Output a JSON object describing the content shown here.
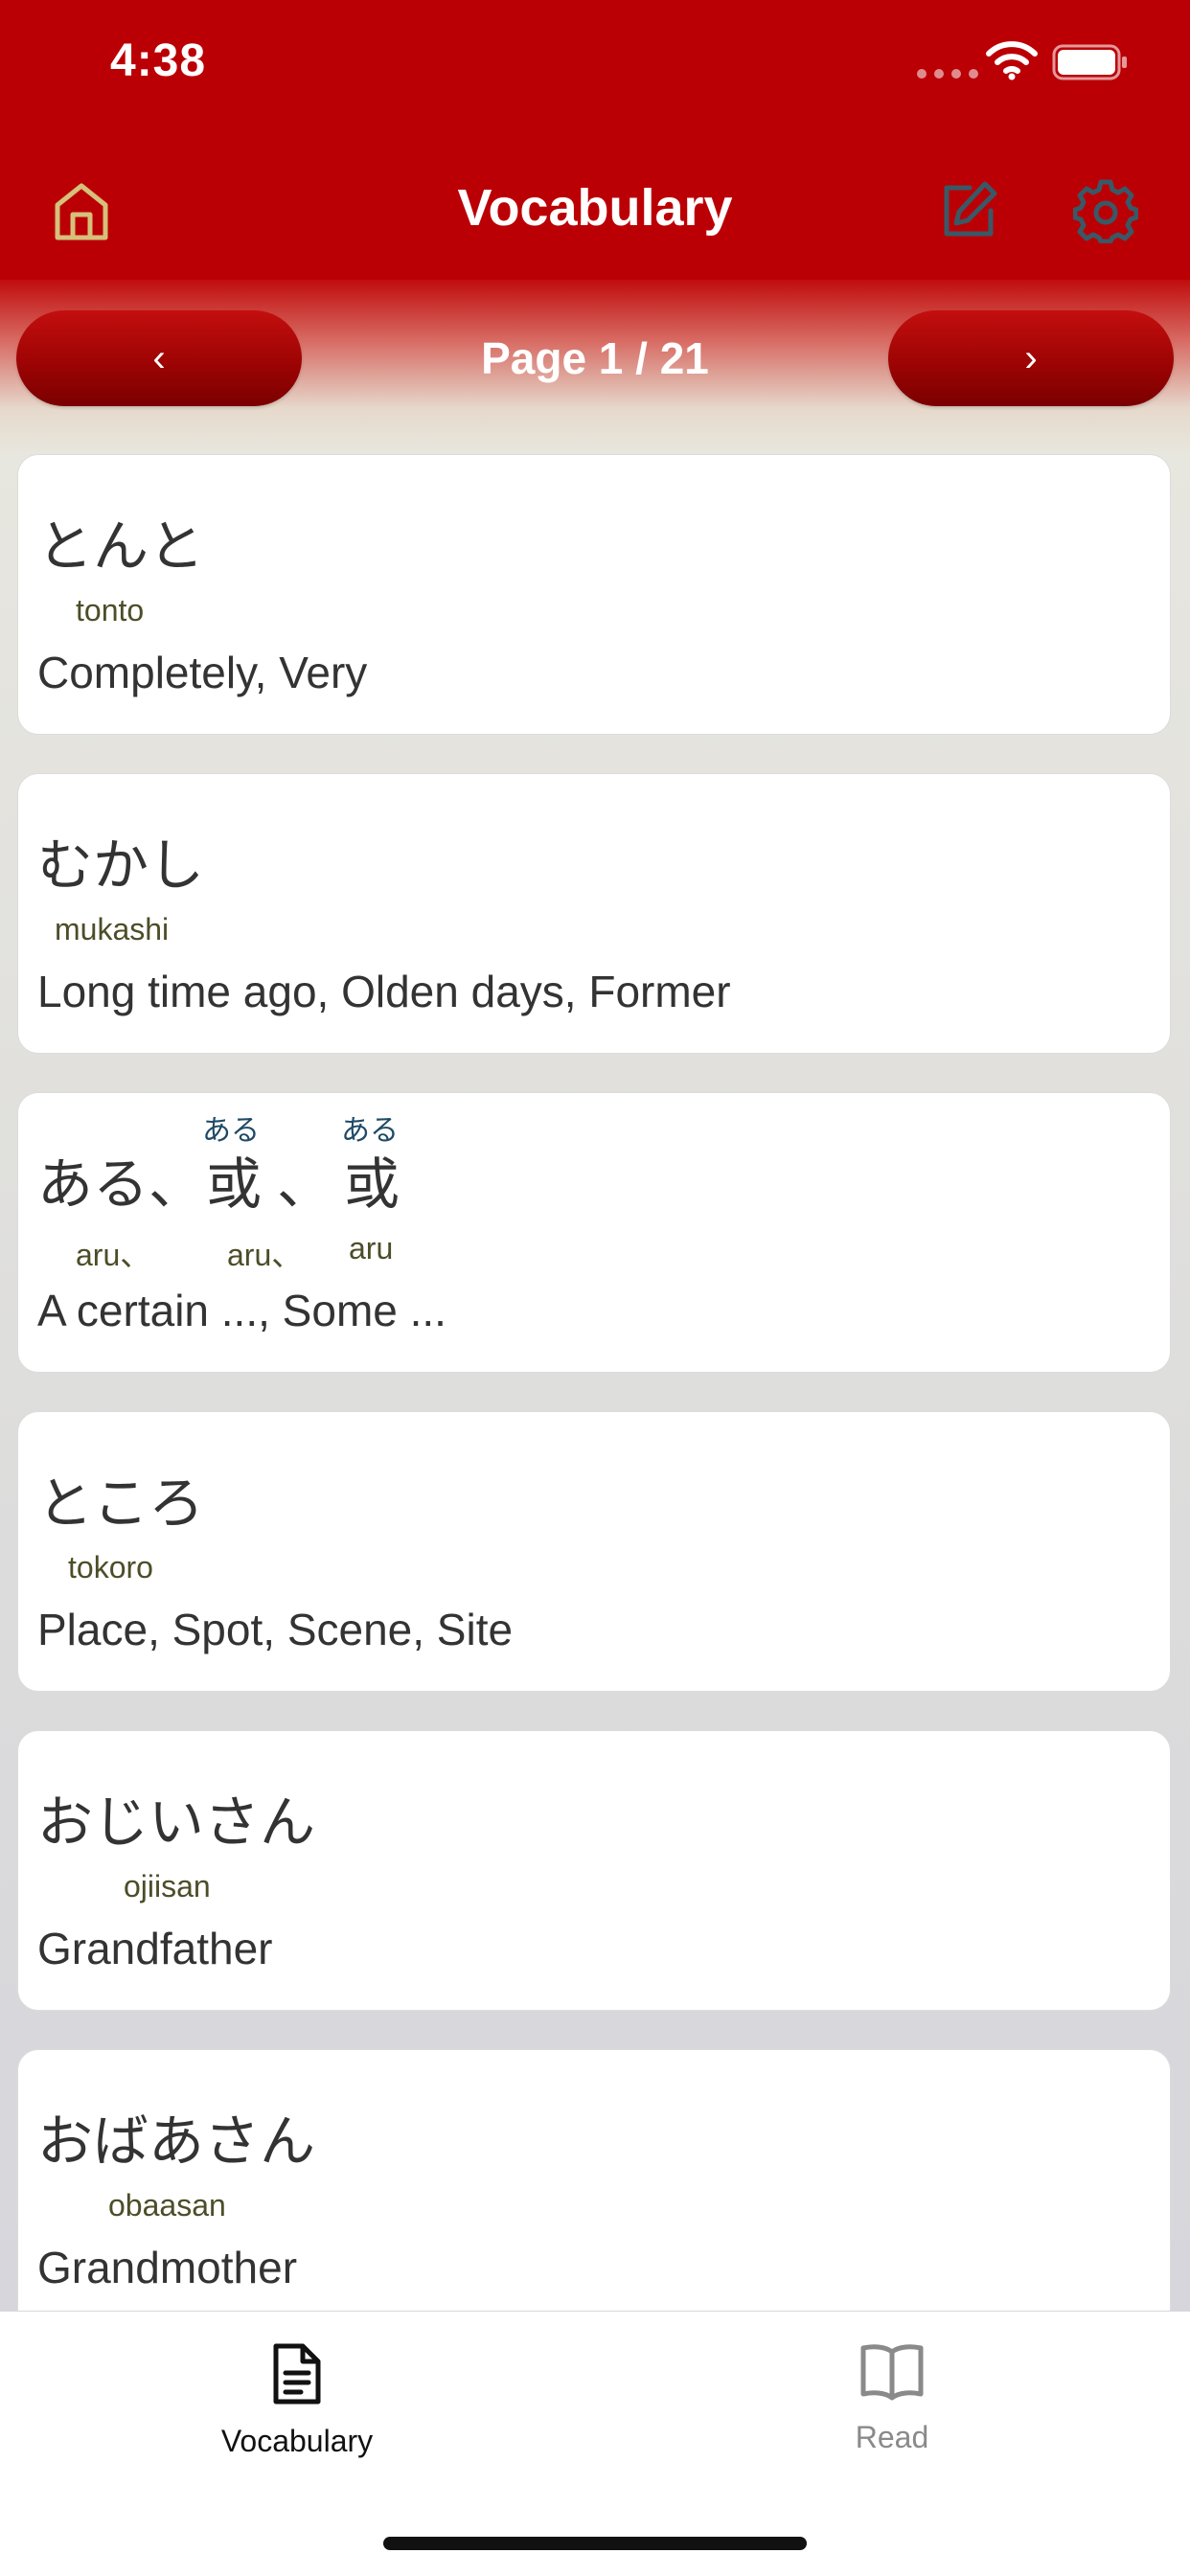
{
  "status_bar": {
    "time": "4:38"
  },
  "header": {
    "title": "Vocabulary"
  },
  "pager": {
    "prev_label": "‹",
    "next_label": "›",
    "page_label": "Page 1 / 21"
  },
  "vocab": [
    {
      "word": "とんと",
      "romaji": "tonto",
      "meaning": "Completely, Very"
    },
    {
      "word": "むかし",
      "romaji": "mukashi",
      "meaning": "Long time ago, Olden days, Former"
    },
    {
      "segments": [
        "ある、",
        "或",
        "、",
        "或"
      ],
      "furigana": [
        "ある",
        "ある"
      ],
      "romaji_parts": [
        "aru、",
        "aru、",
        "aru"
      ],
      "meaning": "A certain ..., Some ..."
    },
    {
      "word": "ところ",
      "romaji": "tokoro",
      "meaning": "Place, Spot, Scene, Site"
    },
    {
      "word": "おじいさん",
      "romaji": "ojiisan",
      "meaning": "Grandfather"
    },
    {
      "word": "おばあさん",
      "romaji": "obaasan",
      "meaning": "Grandmother"
    }
  ],
  "tabs": [
    {
      "label": "Vocabulary",
      "icon": "document-icon",
      "active": true
    },
    {
      "label": "Read",
      "icon": "book-icon",
      "active": false
    }
  ],
  "colors": {
    "brand_red": "#bb0005",
    "active_tab": "#111111",
    "inactive_tab": "#8a8a8a"
  }
}
